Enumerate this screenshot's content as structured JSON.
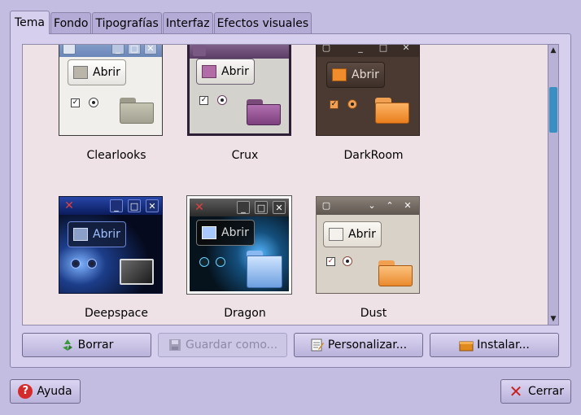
{
  "tabs": [
    {
      "label": "Tema",
      "active": true
    },
    {
      "label": "Fondo"
    },
    {
      "label": "Tipografías"
    },
    {
      "label": "Interfaz"
    },
    {
      "label": "Efectos visuales"
    }
  ],
  "themes": [
    {
      "name": "Clearlooks",
      "button_label": "Abrir"
    },
    {
      "name": "Crux",
      "button_label": "Abrir"
    },
    {
      "name": "DarkRoom",
      "button_label": "Abrir"
    },
    {
      "name": "Deepspace",
      "button_label": "Abrir"
    },
    {
      "name": "Dragon",
      "button_label": "Abrir"
    },
    {
      "name": "Dust",
      "button_label": "Abrir"
    }
  ],
  "actions": {
    "delete_label": "Borrar",
    "save_as_label": "Guardar como...",
    "customize_label": "Personalizar...",
    "install_label": "Instalar..."
  },
  "dialog": {
    "help_label": "Ayuda",
    "close_label": "Cerrar"
  },
  "colors": {
    "window_bg": "#c3bde1",
    "list_bg": "#efe2e6",
    "scroll_thumb": "#3a8fc2"
  }
}
